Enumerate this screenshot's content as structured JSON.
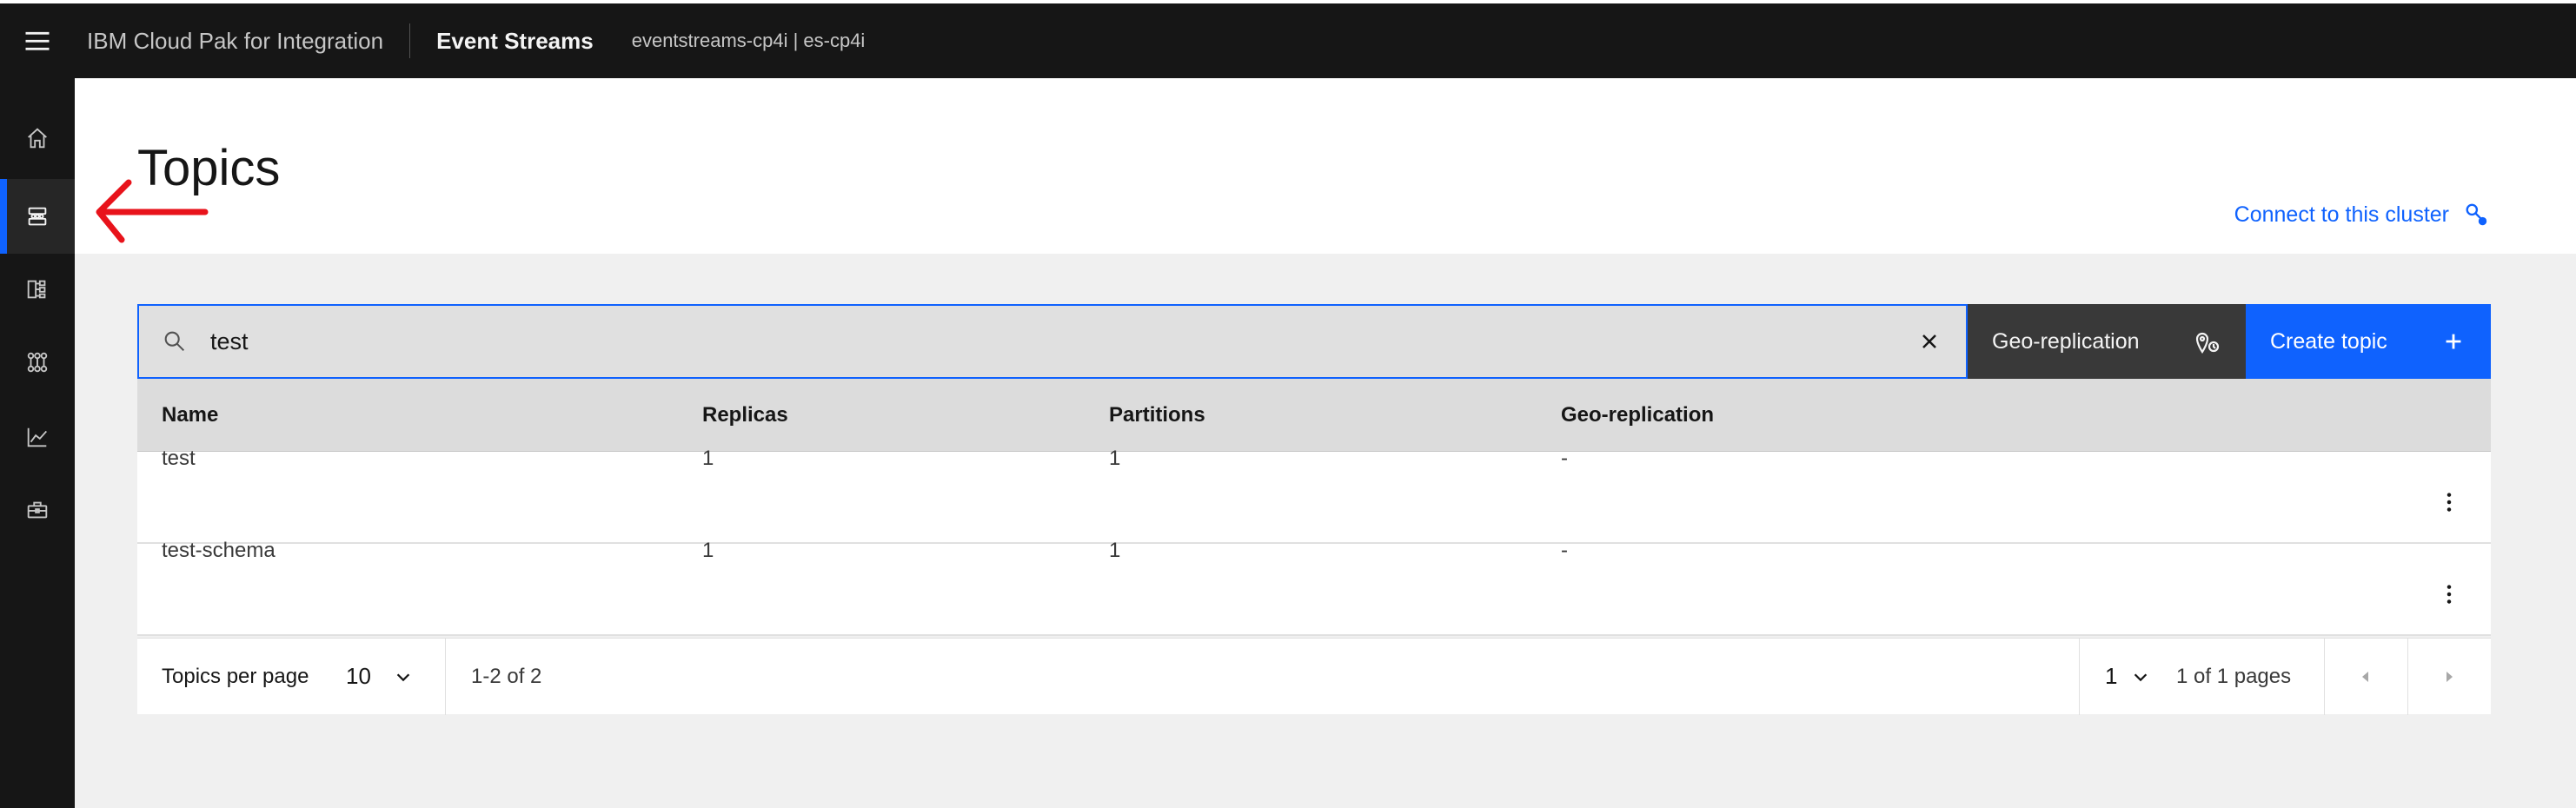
{
  "header": {
    "brand": "IBM Cloud Pak for Integration",
    "product": "Event Streams",
    "instance": "eventstreams-cp4i | es-cp4i"
  },
  "sidebar": {
    "items": [
      {
        "icon": "home-icon"
      },
      {
        "icon": "topics-icon",
        "active": true
      },
      {
        "icon": "consumer-groups-icon"
      },
      {
        "icon": "schema-registry-icon"
      },
      {
        "icon": "monitoring-icon"
      },
      {
        "icon": "toolbox-icon"
      }
    ]
  },
  "page": {
    "title": "Topics",
    "connect_label": "Connect to this cluster"
  },
  "toolbar": {
    "search_value": "test",
    "geo_label": "Geo-replication",
    "create_label": "Create topic"
  },
  "table": {
    "columns": [
      "Name",
      "Replicas",
      "Partitions",
      "Geo-replication"
    ],
    "rows": [
      {
        "name": "test",
        "replicas": "1",
        "partitions": "1",
        "geo": "-"
      },
      {
        "name": "test-schema",
        "replicas": "1",
        "partitions": "1",
        "geo": "-"
      }
    ]
  },
  "pagination": {
    "per_page_label": "Topics per page",
    "per_page_value": "10",
    "range": "1-2 of 2",
    "current_page": "1",
    "page_of": "1 of 1 pages"
  },
  "colors": {
    "accent": "#0f62fe",
    "header_bg": "#161616",
    "annotation": "#e8131b"
  }
}
